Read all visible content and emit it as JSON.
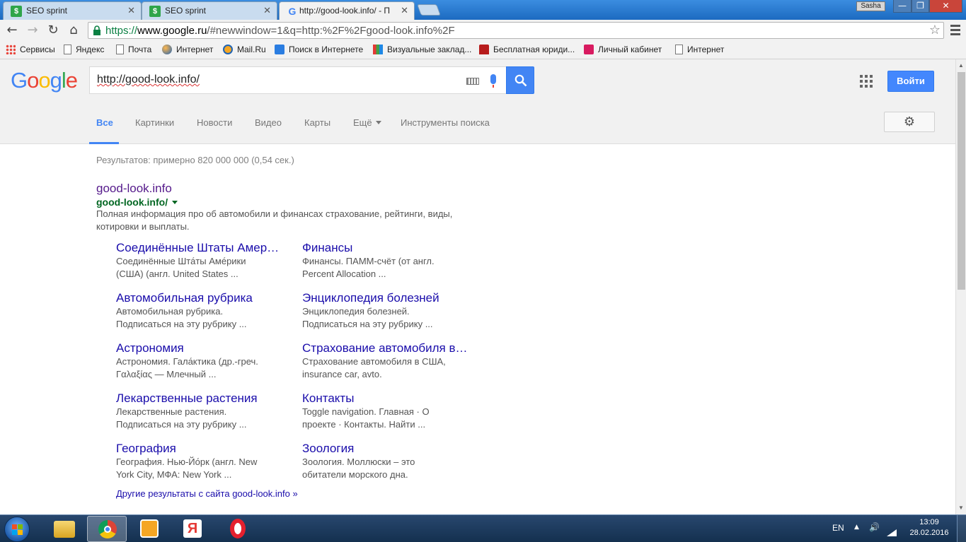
{
  "browser": {
    "tabs": [
      {
        "title": "SEO sprint",
        "favicon": "seo-sprint-icon"
      },
      {
        "title": "SEO sprint",
        "favicon": "seo-sprint-icon"
      },
      {
        "title": "http://good-look.info/ - П",
        "favicon": "google-icon"
      }
    ],
    "user": "Sasha",
    "window_controls": {
      "min": "—",
      "max": "❐",
      "close": "✕"
    },
    "nav": {
      "back": "←",
      "forward": "→",
      "reload": "↻",
      "home": "⌂"
    },
    "address": {
      "scheme": "https://",
      "host": "www.google.ru",
      "path": "/#newwindow=1&q=http:%2F%2Fgood-look.info%2F",
      "star": "☆"
    },
    "bookmarks": [
      {
        "label": "Сервисы",
        "icon": "apps-grid-icon"
      },
      {
        "label": "Яндекс",
        "icon": "page-icon"
      },
      {
        "label": "Почта",
        "icon": "page-icon"
      },
      {
        "label": "Интернет",
        "icon": "globe-icon"
      },
      {
        "label": "Mail.Ru",
        "icon": "mailru-icon"
      },
      {
        "label": "Поиск в Интернете",
        "icon": "search-icon"
      },
      {
        "label": "Визуальные заклад...",
        "icon": "grid-icon"
      },
      {
        "label": "Бесплатная юриди...",
        "icon": "law-icon"
      },
      {
        "label": "Личный кабинет",
        "icon": "cabinet-icon"
      },
      {
        "label": "Интернет",
        "icon": "page-icon"
      }
    ]
  },
  "google": {
    "logo": "Google",
    "query": "http://good-look.info/",
    "signin": "Войти",
    "tabs": [
      {
        "label": "Все",
        "selected": true
      },
      {
        "label": "Картинки"
      },
      {
        "label": "Новости"
      },
      {
        "label": "Видео"
      },
      {
        "label": "Карты"
      },
      {
        "label": "Ещё"
      },
      {
        "label": "Инструменты поиска"
      }
    ],
    "gear": "⚙"
  },
  "results": {
    "stats": "Результатов: примерно 820 000 000 (0,54 сек.)",
    "main": {
      "title": "good-look.info",
      "url": "good-look.info/",
      "snippet": "Полная информация про об автомобили и финансах страхование, рейтинги, виды, котировки и выплаты."
    },
    "sitelinks": [
      {
        "title": "Соединённые Штаты Амер…",
        "desc1": "Соединённые Шта́ты Аме́рики",
        "desc2": "(США) (англ. United States ..."
      },
      {
        "title": "Финансы",
        "desc1": "Финансы. ПАММ-счёт (от англ.",
        "desc2": "Percent Allocation ..."
      },
      {
        "title": "Автомобильная рубрика",
        "desc1": "Автомобильная рубрика.",
        "desc2": "Подписаться на эту рубрику ..."
      },
      {
        "title": "Энциклопедия болезней",
        "desc1": "Энциклопедия болезней.",
        "desc2": "Подписаться на эту рубрику ..."
      },
      {
        "title": "Астрономия",
        "desc1": "Астрономия. Гала́ктика (др.-греч.",
        "desc2": "Γαλαξίας — Млечный ..."
      },
      {
        "title": "Страхование автомобиля в…",
        "desc1": "Страхование автомобиля в США,",
        "desc2": "insurance car, avto."
      },
      {
        "title": "Лекарственные растения",
        "desc1": "Лекарственные растения.",
        "desc2": "Подписаться на эту рубрику ..."
      },
      {
        "title": "Контакты",
        "desc1": "Toggle navigation. Главная · О",
        "desc2": "проекте · Контакты. Найти ..."
      },
      {
        "title": "География",
        "desc1": "География. Нью-Йо́рк (англ. New",
        "desc2": "York City, МФА: New York ..."
      },
      {
        "title": "Зоология",
        "desc1": "Зоология. Моллюски – это",
        "desc2": "обитатели морского дна."
      }
    ],
    "more": "Другие результаты с сайта good-look.info »"
  },
  "taskbar": {
    "lang": "EN",
    "time": "13:09",
    "date": "28.02.2016",
    "apps": [
      "explorer-icon",
      "chrome-icon",
      "media-player-icon",
      "yandex-browser-icon",
      "opera-icon"
    ]
  },
  "colors": {
    "link": "#1a0dab",
    "visited": "#551a8b",
    "url_green": "#006621",
    "accent_blue": "#4285f4"
  }
}
